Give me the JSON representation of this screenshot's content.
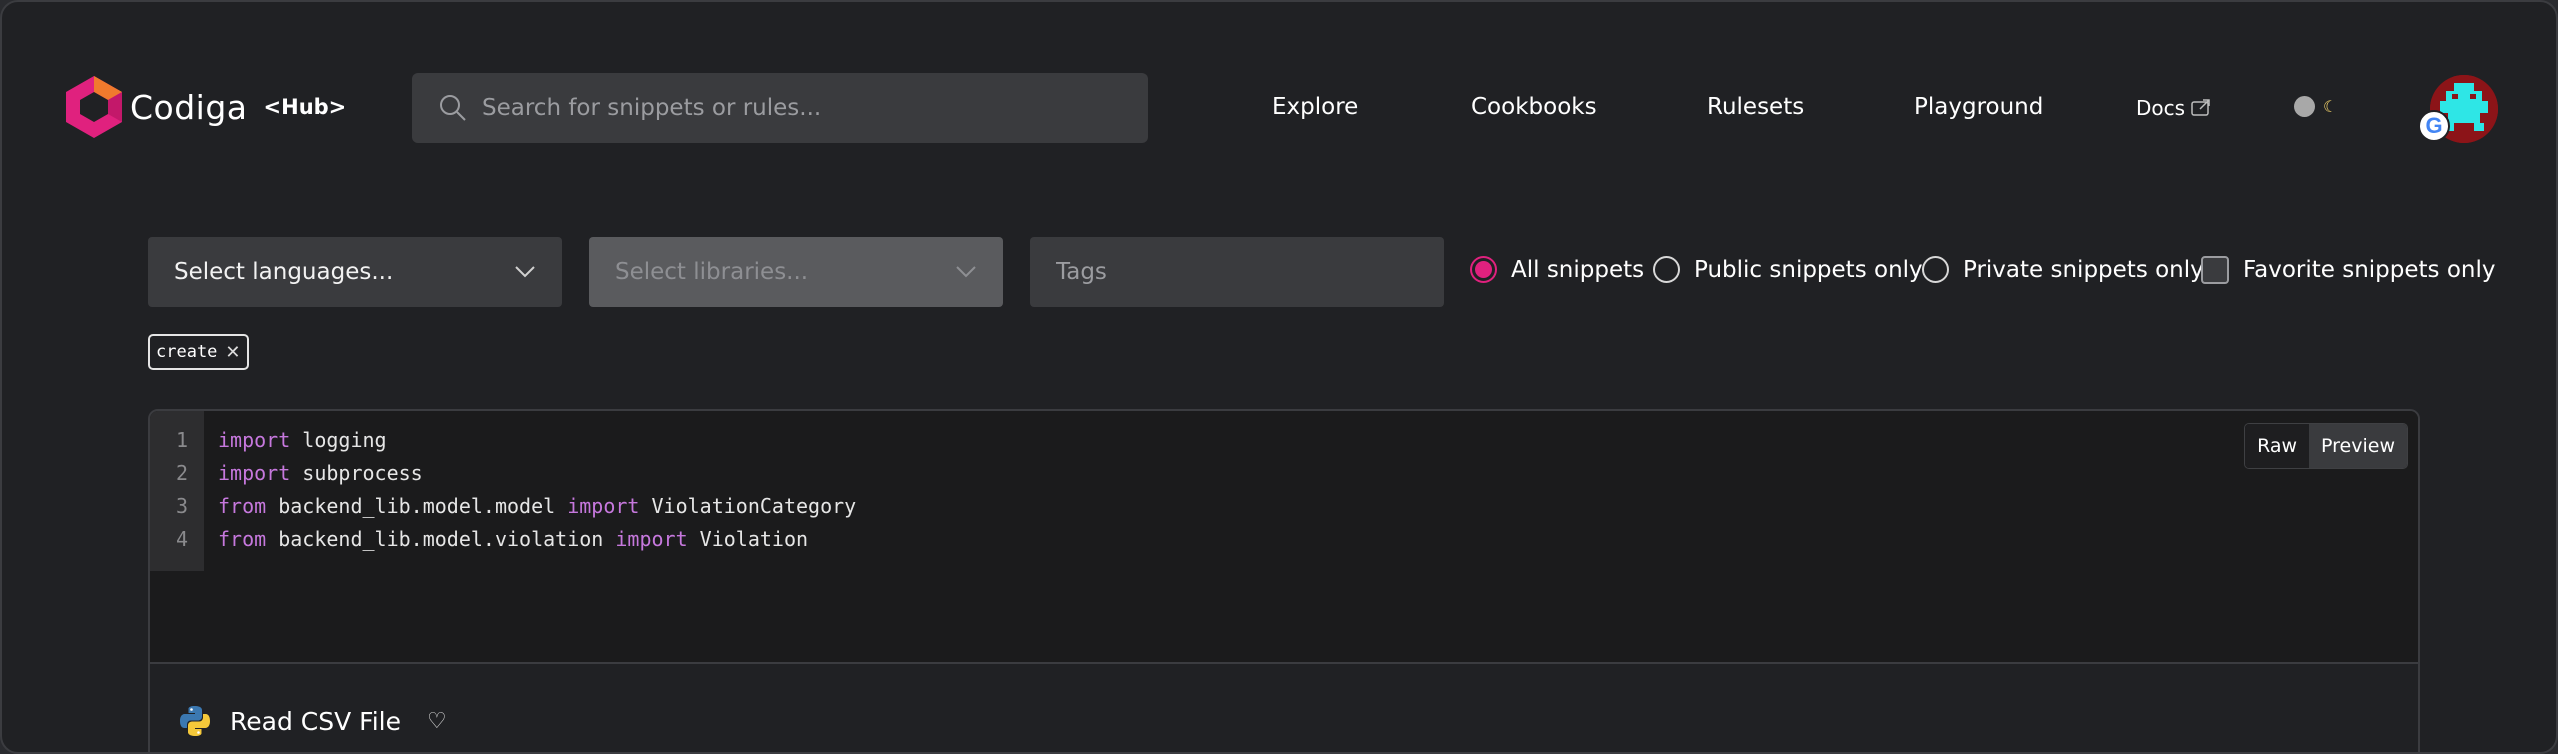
{
  "header": {
    "brand": "Codiga",
    "brand_suffix": "<Hub>",
    "search_placeholder": "Search for snippets or rules...",
    "nav": [
      "Explore",
      "Cookbooks",
      "Rulesets",
      "Playground"
    ],
    "docs_label": "Docs",
    "theme_icon": "moon-icon",
    "avatar_badge": "G"
  },
  "filters": {
    "languages_placeholder": "Select languages...",
    "libraries_placeholder": "Select libraries...",
    "tags_placeholder": "Tags",
    "options": [
      {
        "label": "All snippets",
        "selected": true
      },
      {
        "label": "Public snippets only",
        "selected": false
      },
      {
        "label": "Private snippets only",
        "selected": false
      }
    ],
    "favorite_label": "Favorite snippets only",
    "active_tag": "create",
    "accent_color": "#e0217e"
  },
  "snippet": {
    "lines": [
      {
        "num": "1",
        "parts": [
          {
            "t": "import",
            "kw": true
          },
          {
            "t": " logging",
            "kw": false
          }
        ]
      },
      {
        "num": "2",
        "parts": [
          {
            "t": "import",
            "kw": true
          },
          {
            "t": " subprocess",
            "kw": false
          }
        ]
      },
      {
        "num": "3",
        "parts": [
          {
            "t": "from",
            "kw": true
          },
          {
            "t": " backend_lib.model.model ",
            "kw": false
          },
          {
            "t": "import",
            "kw": true
          },
          {
            "t": " ViolationCategory",
            "kw": false
          }
        ]
      },
      {
        "num": "4",
        "parts": [
          {
            "t": "from",
            "kw": true
          },
          {
            "t": " backend_lib.model.violation ",
            "kw": false
          },
          {
            "t": "import",
            "kw": true
          },
          {
            "t": " Violation",
            "kw": false
          }
        ]
      }
    ],
    "view_modes": [
      "Raw",
      "Preview"
    ],
    "active_view": "Preview",
    "title": "Read CSV File",
    "language_icon": "python-icon"
  }
}
